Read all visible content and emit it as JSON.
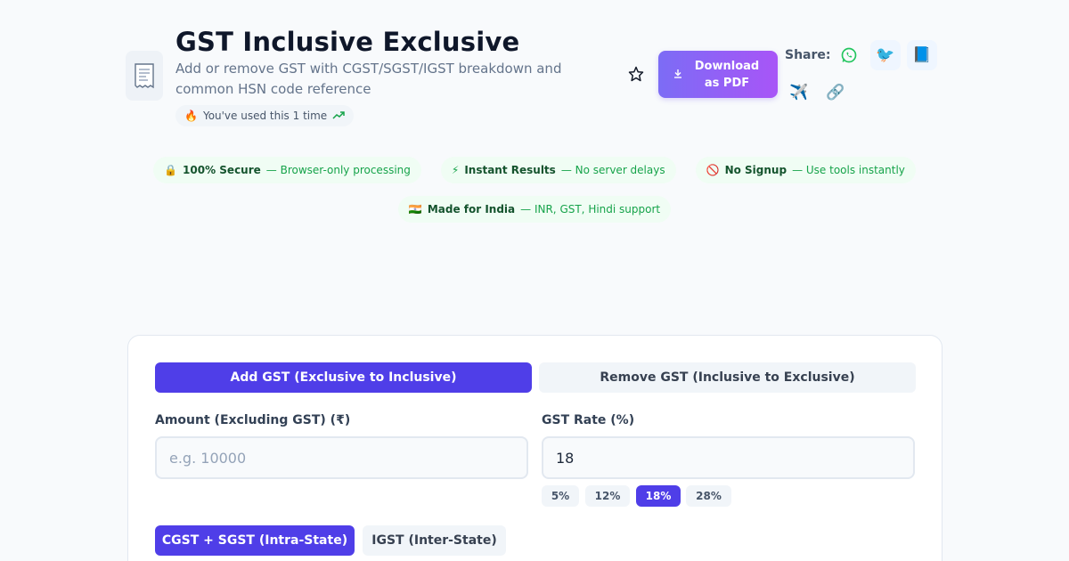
{
  "header": {
    "title": "GST Inclusive Exclusive",
    "subtitle": "Add or remove GST with CGST/SGST/IGST breakdown and common HSN code reference",
    "usage_text": "You've used this 1 time",
    "usage_emoji": "🔥",
    "app_icon": "receipt-icon"
  },
  "actions": {
    "download_label": "Download as PDF",
    "share_label": "Share:",
    "share_icons": [
      "whatsapp-icon",
      "twitter-icon",
      "facebook-icon",
      "telegram-icon",
      "link-icon"
    ],
    "share_glyphs": [
      "✆",
      "🐦",
      "📘",
      "✈️",
      "🔗"
    ]
  },
  "badges": [
    {
      "emoji": "🔒",
      "title": "100% Secure",
      "desc": "— Browser-only processing"
    },
    {
      "emoji": "⚡",
      "title": "Instant Results",
      "desc": "— No server delays"
    },
    {
      "emoji": "🚫",
      "title": "No Signup",
      "desc": "— Use tools instantly"
    },
    {
      "emoji": "🇮🇳",
      "title": "Made for India",
      "desc": "— INR, GST, Hindi support"
    }
  ],
  "calculator": {
    "mode_tabs": [
      "Add GST (Exclusive to Inclusive)",
      "Remove GST (Inclusive to Exclusive)"
    ],
    "active_mode": 0,
    "amount_label": "Amount (Excluding GST) (₹)",
    "amount_placeholder": "e.g. 10000",
    "amount_value": "",
    "rate_label": "GST Rate (%)",
    "rate_value": "18",
    "rate_chips": [
      "5%",
      "12%",
      "18%",
      "28%"
    ],
    "active_rate": 2,
    "tax_tabs": [
      "CGST + SGST (Intra-State)",
      "IGST (Inter-State)"
    ],
    "active_tax": 0
  },
  "colors": {
    "accent": "#4f3ee8",
    "pdf_gradient_start": "#7c6cf5",
    "pdf_gradient_end": "#a855f7",
    "badge_bg": "#f0fdf4",
    "badge_text": "#16a34a"
  }
}
